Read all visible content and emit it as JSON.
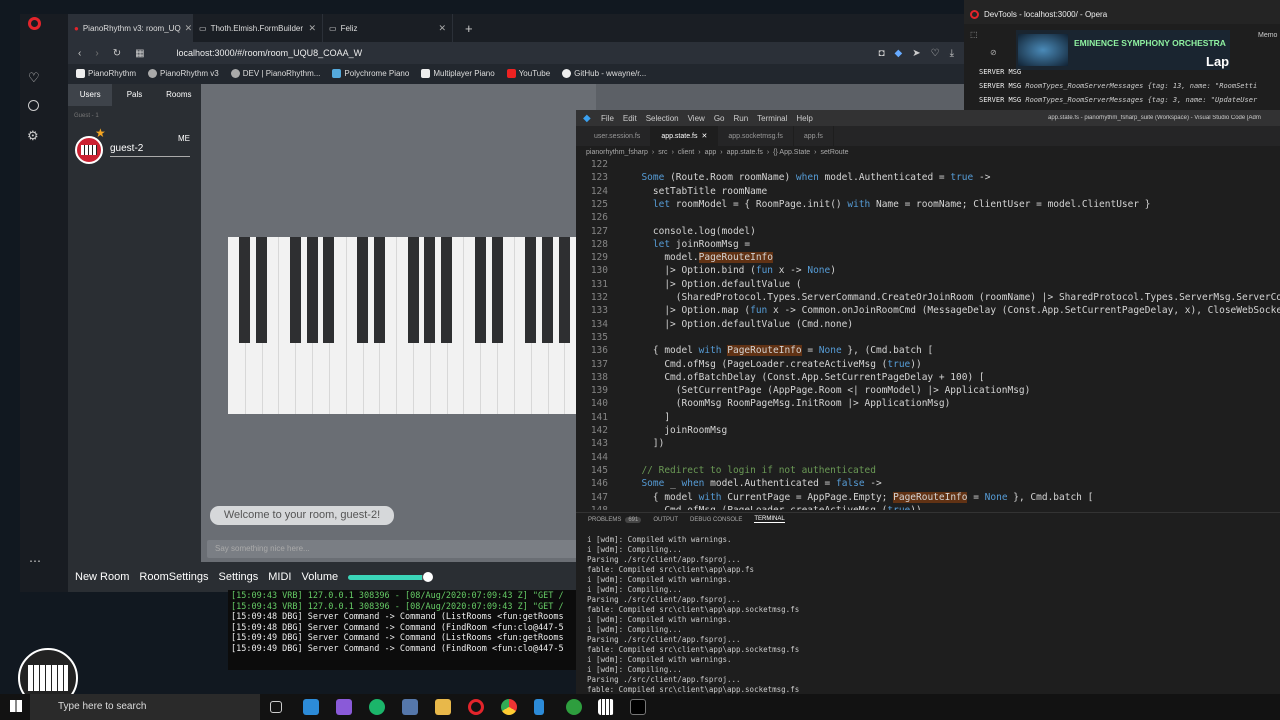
{
  "browser": {
    "tabs": [
      {
        "label": "PianoRhythm v3: room_UQ"
      },
      {
        "label": "Thoth.Elmish.FormBuilder"
      },
      {
        "label": "Feliz"
      }
    ],
    "url": "localhost:3000/#/room/room_UQU8_COAA_W",
    "bookmarks": [
      "PianoRhythm",
      "PianoRhythm v3",
      "DEV | PianoRhythm...",
      "Polychrome Piano",
      "Multiplayer Piano",
      "YouTube",
      "GitHub - wwayne/r..."
    ]
  },
  "app": {
    "user_tabs": [
      "Users",
      "Pals",
      "Rooms"
    ],
    "guest_hint": "Guest - 1",
    "user_name": "guest-2",
    "me_badge": "ME",
    "welcome": "Welcome to your room, guest-2!",
    "chat_placeholder": "Say something nice here...",
    "bottom_buttons": [
      "New Room",
      "RoomSettings",
      "Settings",
      "MIDI",
      "Volume"
    ],
    "volume_level": 0.9
  },
  "bg_terminal": [
    "[15:09:43 VRB] 127.0.0.1 308396 - [08/Aug/2020:07:09:43 Z] \"GET /",
    "[15:09:43 VRB] 127.0.0.1 308396 - [08/Aug/2020:07:09:43 Z] \"GET /",
    "[15:09:48 DBG] Server Command -> Command (ListRooms <fun:getRooms",
    "[15:09:48 DBG] Server Command -> Command (FindRoom <fun:clo@447-5",
    "[15:09:49 DBG] Server Command -> Command (ListRooms <fun:getRooms",
    "[15:09:49 DBG] Server Command -> Command (FindRoom <fun:clo@447-5"
  ],
  "devtools": {
    "title": "DevTools - localhost:3000/ - Opera",
    "banner": "EMINENCE SYMPHONY ORCHESTRA",
    "banner2": "Lap",
    "memo": "Memo",
    "lines": [
      {
        "prefix": "SERVER MSG",
        "text": "RoomTypes_RoomServerMessages {tag: 13, name: \"RoomSetti"
      },
      {
        "prefix": "SERVER MSG",
        "text": "RoomTypes_RoomServerMessages {tag: 3, name: \"UpdateUser"
      }
    ]
  },
  "vscode": {
    "menu": [
      "File",
      "Edit",
      "Selection",
      "View",
      "Go",
      "Run",
      "Terminal",
      "Help"
    ],
    "title": "app.state.fs - pianorhythm_fsharp_suite (Workspace) - Visual Studio Code [Adm",
    "tabs": [
      "user.session.fs",
      "app.state.fs",
      "app.socketmsg.fs",
      "app.fs"
    ],
    "breadcrumbs": [
      "pianorhythm_fsharp",
      "src",
      "client",
      "app",
      "app.state.fs",
      "{} App.State",
      "setRoute"
    ],
    "code": [
      {
        "n": "122",
        "t": ""
      },
      {
        "n": "123",
        "t": "  Some (Route.Room roomName) when model.Authenticated = true ->"
      },
      {
        "n": "124",
        "t": "    setTabTitle roomName"
      },
      {
        "n": "125",
        "t": "    let roomModel = { RoomPage.init() with Name = roomName; ClientUser = model.ClientUser }"
      },
      {
        "n": "126",
        "t": ""
      },
      {
        "n": "127",
        "t": "    console.log(model)"
      },
      {
        "n": "128",
        "t": "    let joinRoomMsg ="
      },
      {
        "n": "129",
        "t": "      model.PageRouteInfo"
      },
      {
        "n": "130",
        "t": "      |> Option.bind (fun x -> None)"
      },
      {
        "n": "131",
        "t": "      |> Option.defaultValue ("
      },
      {
        "n": "132",
        "t": "        (SharedProtocol.Types.ServerCommand.CreateOrJoinRoom (roomName) |> SharedProtocol.Types.ServerMsg.ServerCommand"
      },
      {
        "n": "133",
        "t": "      |> Option.map (fun x -> Common.onJoinRoomCmd (MessageDelay (Const.App.SetCurrentPageDelay, x), CloseWebSocket) |>"
      },
      {
        "n": "134",
        "t": "      |> Option.defaultValue (Cmd.none)"
      },
      {
        "n": "135",
        "t": ""
      },
      {
        "n": "136",
        "t": "    { model with PageRouteInfo = None }, (Cmd.batch ["
      },
      {
        "n": "137",
        "t": "      Cmd.ofMsg (PageLoader.createActiveMsg (true))"
      },
      {
        "n": "138",
        "t": "      Cmd.ofBatchDelay (Const.App.SetCurrentPageDelay + 100) ["
      },
      {
        "n": "139",
        "t": "        (SetCurrentPage (AppPage.Room <| roomModel) |> ApplicationMsg)"
      },
      {
        "n": "140",
        "t": "        (RoomMsg RoomPageMsg.InitRoom |> ApplicationMsg)"
      },
      {
        "n": "141",
        "t": "      ]"
      },
      {
        "n": "142",
        "t": "      joinRoomMsg"
      },
      {
        "n": "143",
        "t": "    ])"
      },
      {
        "n": "144",
        "t": ""
      },
      {
        "n": "145",
        "t": "  // Redirect to login if not authenticated"
      },
      {
        "n": "146",
        "t": "  Some _ when model.Authenticated = false ->"
      },
      {
        "n": "147",
        "t": "    { model with CurrentPage = AppPage.Empty; PageRouteInfo = None }, Cmd.batch ["
      },
      {
        "n": "148",
        "t": "      Cmd.ofMsg (PageLoader.createActiveMsg (true))"
      }
    ],
    "panel_tabs": [
      "PROBLEMS",
      "691",
      "OUTPUT",
      "DEBUG CONSOLE",
      "TERMINAL"
    ],
    "terminal": [
      "i [wdm]: Compiled with warnings.",
      "i [wdm]: Compiling...",
      "Parsing ./src/client/app.fsproj...",
      "fable: Compiled src\\client\\app\\app.fs",
      "i [wdm]: Compiled with warnings.",
      "i [wdm]: Compiling...",
      "Parsing ./src/client/app.fsproj...",
      "fable: Compiled src\\client\\app\\app.socketmsg.fs",
      "i [wdm]: Compiled with warnings.",
      "i [wdm]: Compiling...",
      "Parsing ./src/client/app.fsproj...",
      "fable: Compiled src\\client\\app\\app.socketmsg.fs",
      "i [wdm]: Compiled with warnings.",
      "i [wdm]: Compiling...",
      "Parsing ./src/client/app.fsproj...",
      "fable: Compiled src\\client\\app\\app.socketmsg.fs"
    ]
  },
  "taskbar": {
    "search_placeholder": "Type here to search"
  }
}
